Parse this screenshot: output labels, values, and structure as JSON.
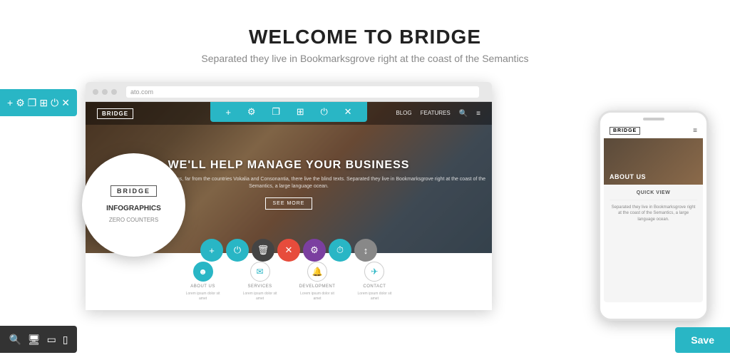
{
  "header": {
    "title": "WELCOME TO BRIDGE",
    "subtitle": "Separated they live in Bookmarksgrove right at the coast of the Semantics"
  },
  "left_toolbar": {
    "icons": [
      "plus",
      "gear",
      "copy",
      "grid",
      "power",
      "trash"
    ]
  },
  "bottom_left_toolbar": {
    "icons": [
      "search",
      "monitor",
      "tablet",
      "mobile"
    ]
  },
  "save_button": {
    "label": "Save"
  },
  "browser": {
    "url": "ato.com",
    "logo": "BRIDGE",
    "nav_links": [
      "BLOG",
      "FEATURES"
    ],
    "hero_title": "WE'LL HELP MANAGE YOUR BUSINESS",
    "hero_desc": "Far far away, behind the word mountains, far from the countries Vokalia and Consonantia, there live the blind texts. Separated they live in Bookmarksgrove right at the coast of the Semantics, a large language ocean.",
    "hero_btn": "SEE MORE"
  },
  "features": [
    {
      "label": "ABOUT US",
      "icon": "person",
      "filled": true
    },
    {
      "label": "SERVICES",
      "icon": "envelope",
      "filled": false
    },
    {
      "label": "DEVELOPMENT",
      "icon": "bell",
      "filled": false
    },
    {
      "label": "CONTACT",
      "icon": "paper-plane",
      "filled": false
    }
  ],
  "circle_overlay": {
    "logo": "BRIDGE",
    "items": [
      "INFOGRAPHICS",
      "ZERO COUNTERS"
    ]
  },
  "mobile": {
    "logo": "BRIDGE",
    "hero_title": "ABOUT US",
    "quick_view": "QUICK VIEW",
    "description": "Separated they live in Bookmarksgrove right at the coast of the Semantics, a large language ocean."
  },
  "colors": {
    "teal": "#29b6c5",
    "purple": "#7b3fa0",
    "dark": "#333333",
    "accent": "#29b6c5"
  }
}
